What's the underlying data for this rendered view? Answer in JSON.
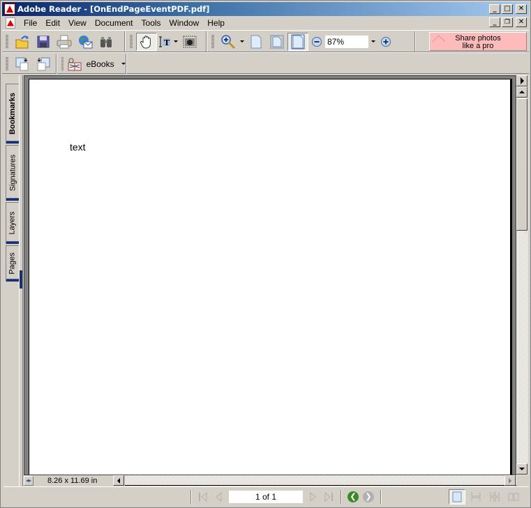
{
  "window": {
    "title": "Adobe Reader - [OnEndPageEventPDF.pdf]",
    "controls": {
      "minimize": "_",
      "maximize": "□",
      "restore": "🗗",
      "close": "✕"
    }
  },
  "menubar": {
    "items": [
      {
        "label": "File"
      },
      {
        "label": "Edit"
      },
      {
        "label": "View"
      },
      {
        "label": "Document"
      },
      {
        "label": "Tools"
      },
      {
        "label": "Window"
      },
      {
        "label": "Help"
      }
    ]
  },
  "toolbar": {
    "file_tools": [
      "open-icon",
      "save-icon",
      "print-icon",
      "email-icon",
      "search-icon"
    ],
    "basic_tools": [
      "hand-tool-icon",
      "select-text-icon",
      "snapshot-icon"
    ],
    "zoom": {
      "value": "87%",
      "tools": [
        "zoom-in-tool-icon",
        "actual-size-icon",
        "fit-page-icon",
        "fit-width-icon",
        "zoom-out-icon",
        "zoom-in-icon"
      ]
    },
    "ebooks_label": "eBooks",
    "share": {
      "line1": "Share photos",
      "line2": "like a pro"
    }
  },
  "sidetabs": [
    {
      "label": "Bookmarks",
      "active": true
    },
    {
      "label": "Signatures",
      "active": false
    },
    {
      "label": "Layers",
      "active": false
    },
    {
      "label": "Pages",
      "active": false
    }
  ],
  "document": {
    "content_text": "text",
    "page_size": "8.26 x 11.69 in"
  },
  "statusbar": {
    "page_indicator": "1 of 1",
    "nav": [
      "first-page-icon",
      "previous-page-icon",
      "next-page-icon",
      "last-page-icon"
    ],
    "history": [
      "go-back-icon",
      "go-forward-icon"
    ],
    "layouts": [
      "single-page-icon",
      "continuous-icon",
      "continuous-facing-icon",
      "facing-icon"
    ]
  }
}
